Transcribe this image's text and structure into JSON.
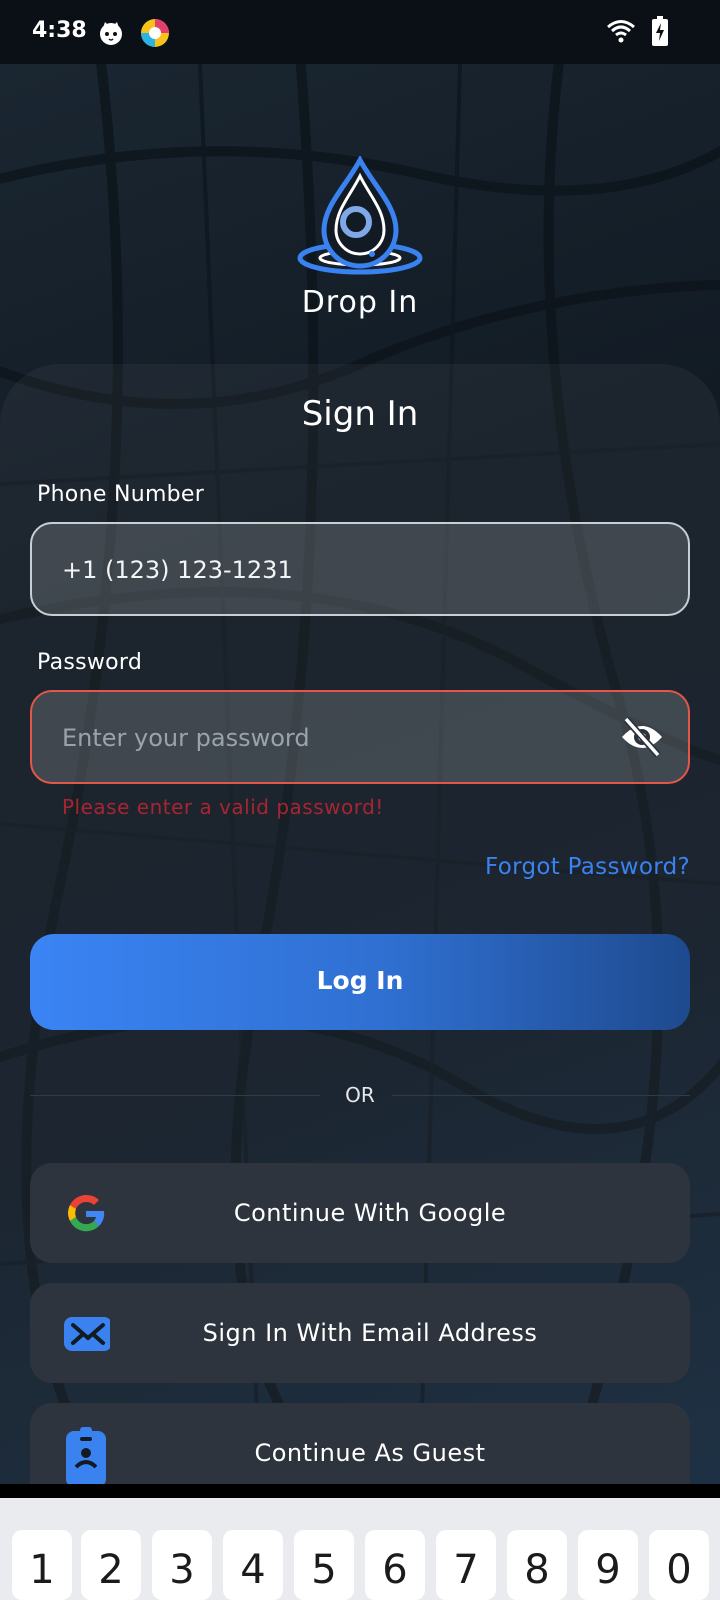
{
  "status_bar": {
    "time": "4:38",
    "icons": [
      "cat-app-icon",
      "colorful-app-icon",
      "wifi-icon",
      "battery-charging-icon"
    ]
  },
  "app": {
    "name": "Drop In",
    "logo": "water-drop-logo-icon",
    "accent_color": "#3a82f0",
    "error_color": "#e2574c"
  },
  "form": {
    "title": "Sign In",
    "phone": {
      "label": "Phone Number",
      "value": "+1 (123) 123-1231"
    },
    "password": {
      "label": "Password",
      "placeholder": "Enter your password",
      "visibility_icon": "eye-off-icon",
      "error": "Please enter a valid password!"
    },
    "forgot_password": "Forgot Password?",
    "login_button": "Log In",
    "divider": "OR"
  },
  "alternatives": [
    {
      "label": "Continue With Google",
      "icon": "google-icon"
    },
    {
      "label": "Sign In With Email Address",
      "icon": "email-icon"
    },
    {
      "label": "Continue As Guest",
      "icon": "guest-badge-icon"
    }
  ],
  "keyboard": {
    "keys": [
      "1",
      "2",
      "3",
      "4",
      "5",
      "6",
      "7",
      "8",
      "9",
      "0"
    ]
  }
}
